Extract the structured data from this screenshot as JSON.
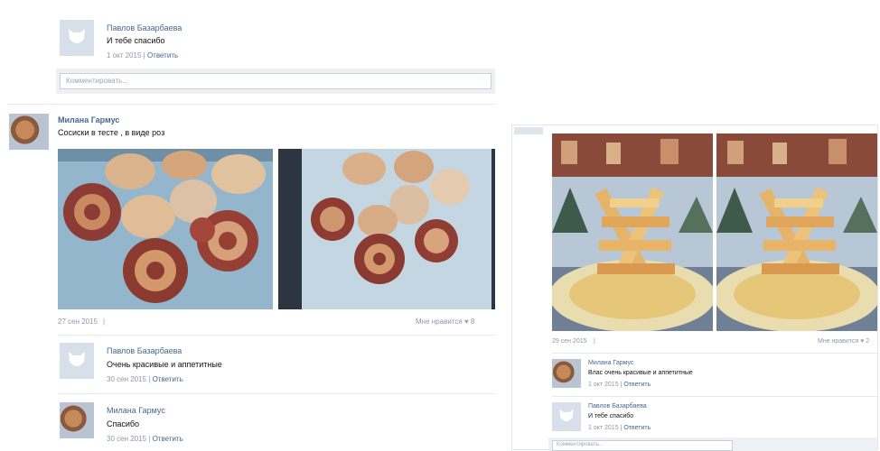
{
  "left": {
    "top_comment": {
      "author": "Павлов Базарбаева",
      "text": "И тебе спасибо",
      "date": "1 окт 2015",
      "reply": "Ответить"
    },
    "comment_placeholder": "Комментировать...",
    "post": {
      "author": "Милана Гармус",
      "text": "Сосиски в тесте , в виде роз",
      "date": "27 сен 2015",
      "likes_label": "Мне нравится",
      "likes_count": "8"
    },
    "comments": [
      {
        "author": "Павлов Базарбаева",
        "text": "Очень красивые и аппетитные",
        "date": "30 сен 2015",
        "reply": "Ответить",
        "avatar": "vk"
      },
      {
        "author": "Милана Гармус",
        "text": "Спасибо",
        "date": "30 сен 2015",
        "reply": "Ответить",
        "avatar": "photo"
      }
    ]
  },
  "right": {
    "post": {
      "date": "29 сен 2015",
      "likes_label": "Мне нравится",
      "likes_count": "2"
    },
    "comments": [
      {
        "author": "Милана Гармус",
        "text": "Влас очень красивые и аппетитные",
        "date": "1 окт 2015",
        "reply": "Ответить",
        "avatar": "photo"
      },
      {
        "author": "Павлов Базарбаева",
        "text": "И тебе спасибо",
        "date": "1 окт 2015",
        "reply": "Ответить",
        "avatar": "vk"
      }
    ],
    "comment_placeholder": "Комментировать..."
  },
  "separator": "|",
  "colors": {
    "link": "#45688e",
    "meta": "#8a99ab",
    "vk_avatar": "#d7dfe8"
  }
}
